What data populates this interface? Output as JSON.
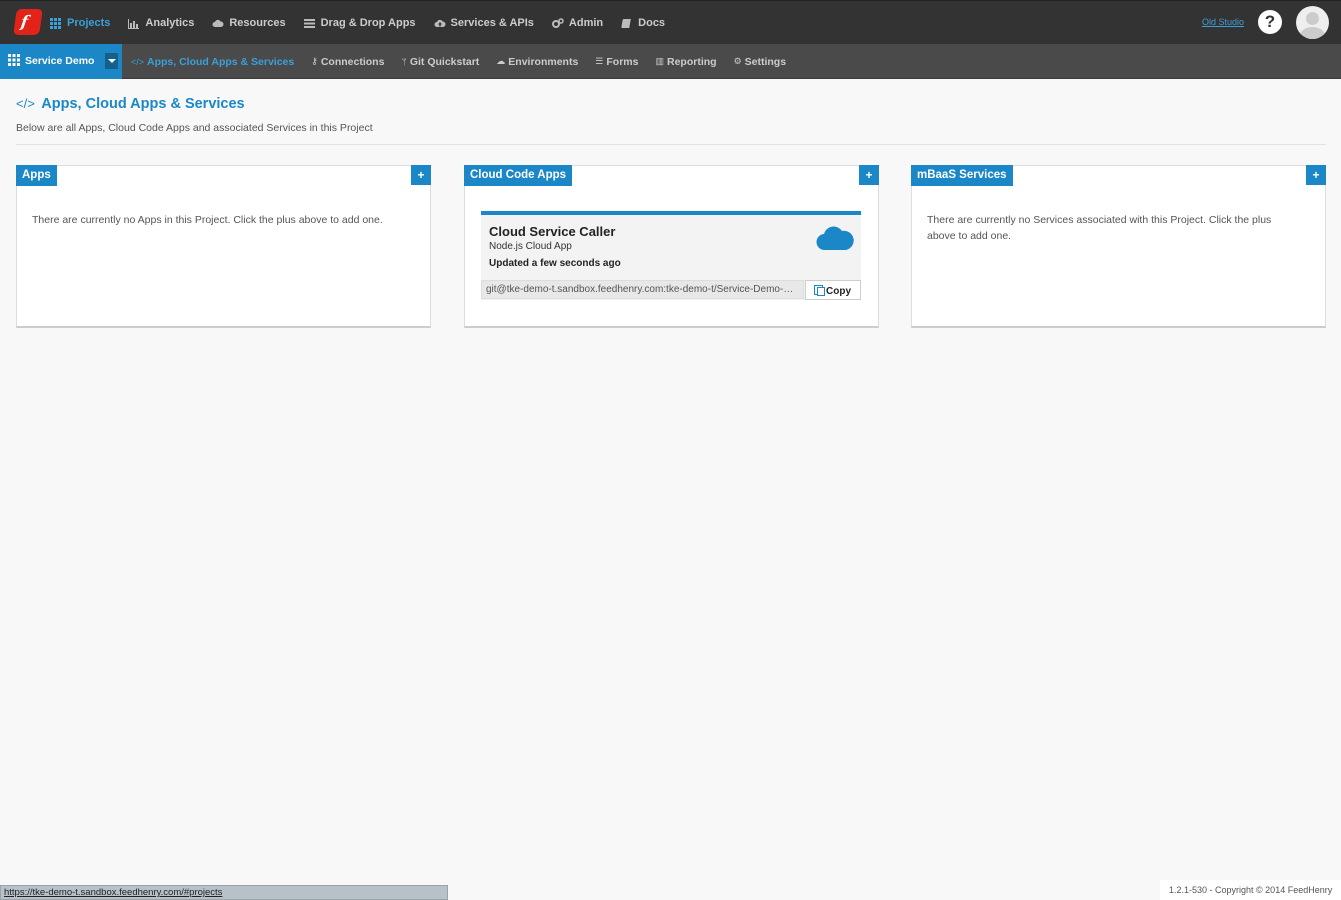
{
  "topnav": {
    "logo_text": "f",
    "items": [
      {
        "label": "Projects",
        "icon": "grid-icon"
      },
      {
        "label": "Analytics",
        "icon": "bar-chart-icon"
      },
      {
        "label": "Resources",
        "icon": "cloud-icon"
      },
      {
        "label": "Drag & Drop Apps",
        "icon": "list-icon"
      },
      {
        "label": "Services & APIs",
        "icon": "cloud-upload-icon"
      },
      {
        "label": "Admin",
        "icon": "gears-icon"
      },
      {
        "label": "Docs",
        "icon": "book-icon"
      }
    ],
    "old_studio": "Old Studio",
    "help": "?",
    "active_color": "#3aa0d8"
  },
  "subnav": {
    "project": "Service Demo",
    "items": [
      {
        "label": "Apps, Cloud Apps & Services",
        "icon": "</>"
      },
      {
        "label": "Connections",
        "icon": "⚷"
      },
      {
        "label": "Git Quickstart",
        "icon": "ᛘ"
      },
      {
        "label": "Environments",
        "icon": "☁"
      },
      {
        "label": "Forms",
        "icon": "☰"
      },
      {
        "label": "Reporting",
        "icon": "▥"
      },
      {
        "label": "Settings",
        "icon": "⚙"
      }
    ]
  },
  "page": {
    "title_icon": "</>",
    "title": "Apps, Cloud Apps & Services",
    "subtitle": "Below are all Apps, Cloud Code Apps and associated Services in this Project"
  },
  "panels": {
    "apps": {
      "title": "Apps",
      "plus": "+",
      "message": "There are currently no Apps in this Project. Click the plus above to add one."
    },
    "cloud": {
      "title": "Cloud Code Apps",
      "plus": "+",
      "card": {
        "name": "Cloud Service Caller",
        "type": "Node.js Cloud App",
        "updated": "Updated a few seconds ago",
        "git_url": "git@tke-demo-t.sandbox.feedhenry.com:tke-demo-t/Service-Demo-Cl...",
        "copy_label": "Copy"
      }
    },
    "mbaas": {
      "title": "mBaaS Services",
      "plus": "+",
      "message": "There are currently no Services associated with this Project. Click the plus above to add one."
    }
  },
  "statusbar": "https://tke-demo-t.sandbox.feedhenry.com/#projects",
  "footer": "1.2.1-530 - Copyright © 2014 FeedHenry",
  "colors": {
    "brand": "#1b87c7",
    "logo": "#e2231a",
    "topbar": "#333333",
    "subbar": "#4a4a4a"
  }
}
